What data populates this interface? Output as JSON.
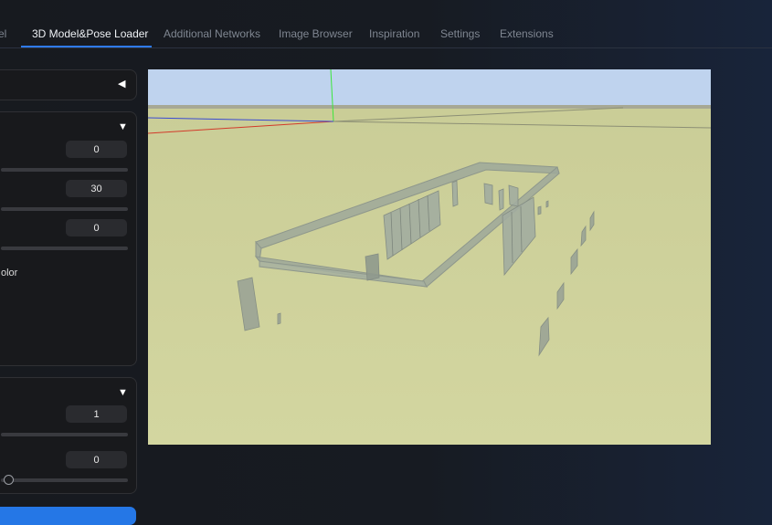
{
  "tabs": [
    {
      "label": "el",
      "active": false
    },
    {
      "label": "3D Model&Pose Loader",
      "active": true
    },
    {
      "label": "Additional Networks",
      "active": false
    },
    {
      "label": "Image Browser",
      "active": false
    },
    {
      "label": "Inspiration",
      "active": false
    },
    {
      "label": "Settings",
      "active": false
    },
    {
      "label": "Extensions",
      "active": false
    }
  ],
  "panel1": {
    "caret": "◀"
  },
  "panel2": {
    "caret": "▼",
    "fields": [
      {
        "value": "0"
      },
      {
        "value": "30"
      },
      {
        "value": "0"
      }
    ],
    "color_label": "olor"
  },
  "panel3": {
    "caret": "▼",
    "fields": [
      {
        "value": "1"
      },
      {
        "value": "0"
      }
    ]
  },
  "colors": {
    "accent": "#2f7bf0",
    "button": "#2577e6",
    "sky": "#bfd3ee",
    "ground": "#cdd198"
  },
  "icons": {
    "collapse": "triangle-left-icon",
    "expand": "triangle-down-icon"
  }
}
